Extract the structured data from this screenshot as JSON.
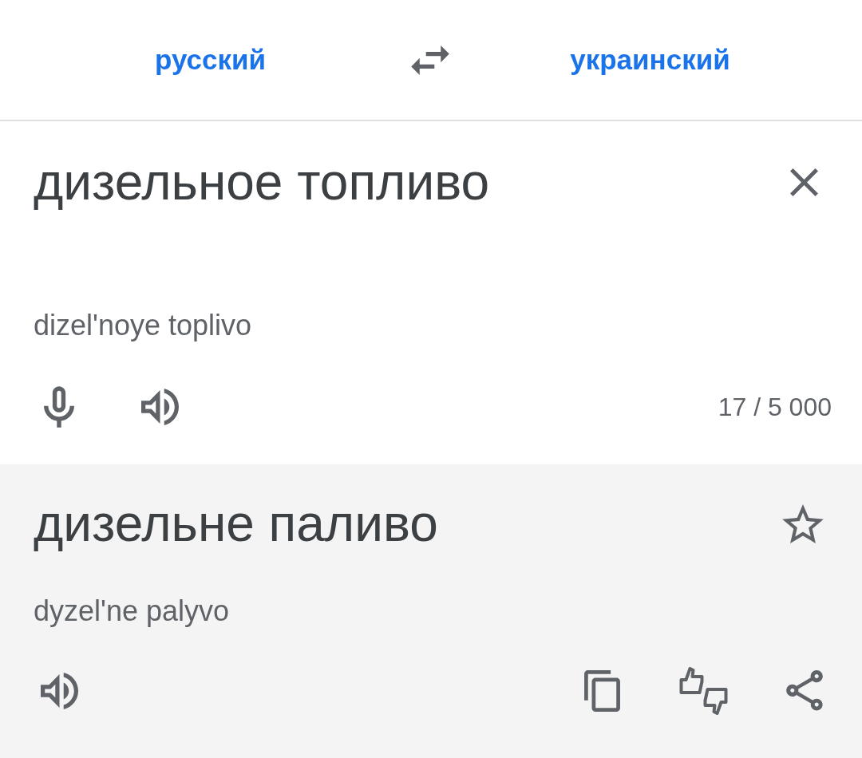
{
  "language_bar": {
    "source_language": {
      "label": "русский"
    },
    "target_language": {
      "label": "украинский"
    }
  },
  "input": {
    "value": "дизельное топливо",
    "transliteration": "dizel'noye toplivo",
    "character_count": "17 / 5 000"
  },
  "output": {
    "text": "дизельне паливо",
    "saved": false,
    "transliteration": "dyzelʹne palyvo"
  }
}
